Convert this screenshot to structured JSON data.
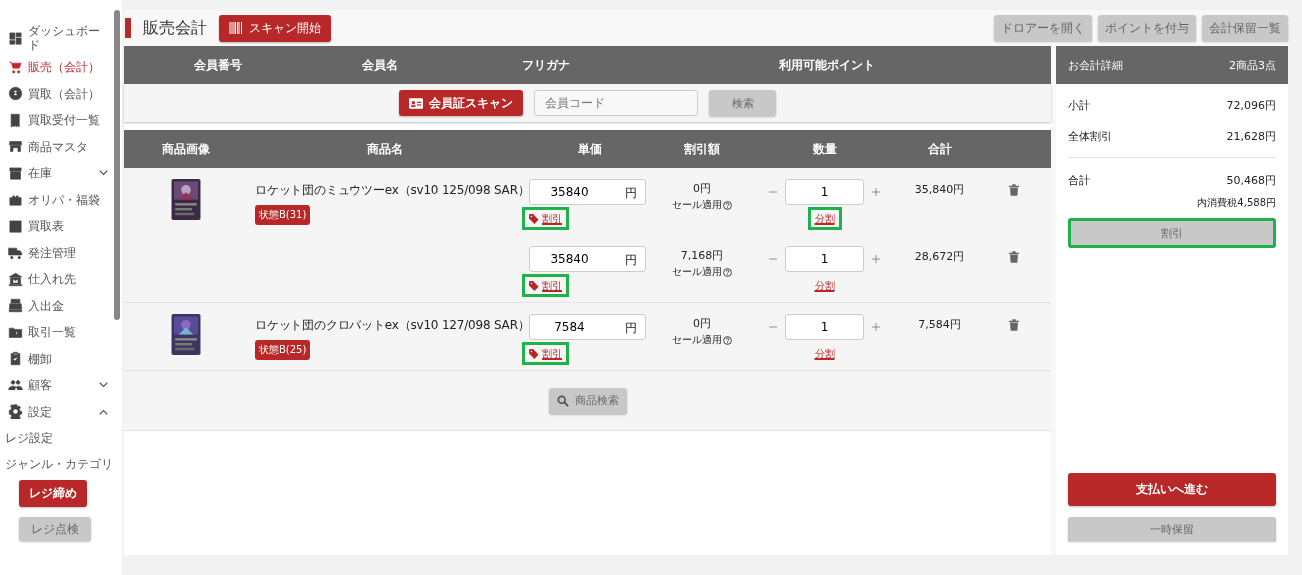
{
  "sidebar": {
    "items": [
      {
        "kind": "link",
        "label": "ダッシュボード",
        "selected": false
      },
      {
        "kind": "link",
        "label": "販売（会計）",
        "selected": true
      },
      {
        "kind": "link",
        "label": "買取（会計）",
        "selected": false
      },
      {
        "kind": "link",
        "label": "買取受付一覧",
        "selected": false
      },
      {
        "kind": "link",
        "label": "商品マスタ",
        "selected": false
      },
      {
        "kind": "group",
        "label": "在庫",
        "selected": false,
        "expanded": false
      },
      {
        "kind": "link",
        "label": "オリパ・福袋",
        "selected": false
      },
      {
        "kind": "link",
        "label": "買取表",
        "selected": false
      },
      {
        "kind": "link",
        "label": "発注管理",
        "selected": false
      },
      {
        "kind": "link",
        "label": "仕入れ先",
        "selected": false
      },
      {
        "kind": "link",
        "label": "入出金",
        "selected": false
      },
      {
        "kind": "link",
        "label": "取引一覧",
        "selected": false
      },
      {
        "kind": "link",
        "label": "棚卸",
        "selected": false
      },
      {
        "kind": "group",
        "label": "顧客",
        "selected": false,
        "expanded": false
      },
      {
        "kind": "group",
        "label": "設定",
        "selected": false,
        "expanded": true,
        "children": [
          {
            "kind": "link",
            "label": "レジ設定",
            "selected": false
          },
          {
            "kind": "link",
            "label": "ジャンル・カテゴリ",
            "selected": false
          }
        ]
      }
    ],
    "close_button": "レジ締め",
    "check_button": "レジ点検"
  },
  "header": {
    "title": "販売会計",
    "scan_button": "スキャン開始",
    "actions": [
      "ドロアーを開く",
      "ポイントを付与",
      "会計保留一覧"
    ]
  },
  "member": {
    "columns": [
      "会員番号",
      "会員名",
      "フリガナ",
      "利用可能ポイント"
    ],
    "card_scan_button": "会員証スキャン",
    "code_placeholder": "会員コード",
    "search_button": "検索"
  },
  "products": {
    "columns": [
      "商品画像",
      "商品名",
      "単価",
      "割引額",
      "数量",
      "合計"
    ],
    "items": [
      {
        "name": "ロケット団のミュウツーex（sv10 125/098 SAR）",
        "condition": "状態B(31)",
        "lines": [
          {
            "price": "35840",
            "unit": "円",
            "discount": "0円",
            "sale_note": "セール適用",
            "qty": "1",
            "total": "35,840円",
            "discount_link": {
              "label": "割引",
              "highlighted": true
            },
            "split_link": {
              "label": "分割",
              "highlighted": true
            }
          },
          {
            "price": "35840",
            "unit": "円",
            "discount": "7,168円",
            "sale_note": "セール適用",
            "qty": "1",
            "total": "28,672円",
            "discount_link": {
              "label": "割引",
              "highlighted": true
            },
            "split_link": {
              "label": "分割",
              "highlighted": false
            }
          }
        ]
      },
      {
        "name": "ロケット団のクロバットex（sv10 127/098 SAR）",
        "condition": "状態B(25)",
        "lines": [
          {
            "price": "7584",
            "unit": "円",
            "discount": "0円",
            "sale_note": "セール適用",
            "qty": "1",
            "total": "7,584円",
            "discount_link": {
              "label": "割引",
              "highlighted": true
            },
            "split_link": {
              "label": "分割",
              "highlighted": false
            }
          }
        ]
      }
    ],
    "search_button": "商品検索"
  },
  "summary": {
    "title": "お会計詳細",
    "count": "2商品3点",
    "rows": [
      {
        "label": "小計",
        "value": "72,096円"
      },
      {
        "label": "全体割引",
        "value": "21,628円"
      }
    ],
    "total_label": "合計",
    "total_value": "50,468円",
    "tax_note": "内消費税4,588円",
    "discount_button": {
      "label": "割引",
      "highlighted": true
    },
    "pay_button": "支払いへ進む",
    "hold_button": "一時保留"
  }
}
